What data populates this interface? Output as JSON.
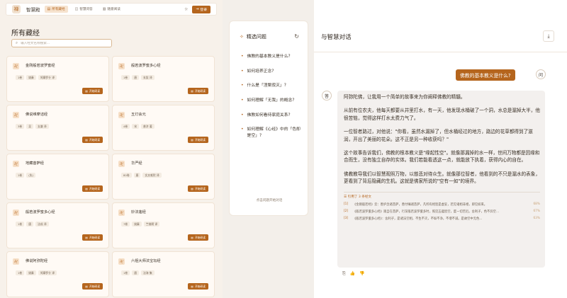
{
  "nav": {
    "brand_icon": "禅",
    "brand_name": "智慧殿",
    "tabs": [
      {
        "label": "所有藏经",
        "icon": "book-icon",
        "glyph": "▤",
        "active": true
      },
      {
        "label": "智慧问答",
        "icon": "chat-icon",
        "glyph": "◫",
        "active": false
      },
      {
        "label": "随意阅读",
        "icon": "read-icon",
        "glyph": "▥",
        "active": false
      }
    ],
    "theme_icon": "☼",
    "login_label": "登录",
    "login_icon": "⇥"
  },
  "library": {
    "title": "所有藏经",
    "search_placeholder": "输入经文名称搜索...",
    "start_label": "开始研读",
    "cards": [
      {
        "icon": "卍",
        "name": "金刚般若波罗蜜经",
        "tags": [
          "1卷",
          "姚秦",
          "鸠摩罗什 译"
        ]
      },
      {
        "icon": "卍",
        "name": "般若波罗蜜多心经",
        "tags": [
          "1卷",
          "唐",
          "玄奘 译"
        ]
      },
      {
        "icon": "卍",
        "name": "佛说维摩诘经",
        "tags": [
          "3卷",
          "吴",
          "支谦 译"
        ]
      },
      {
        "icon": "卍",
        "name": "五灯会元",
        "tags": [
          "4卷",
          "宋",
          "普济 著"
        ]
      },
      {
        "icon": "卍",
        "name": "地藏菩萨经",
        "tags": [
          "1卷",
          "(失)"
        ]
      },
      {
        "icon": "卍",
        "name": "华严经",
        "tags": [
          "80卷",
          "唐",
          "实叉难陀 译"
        ]
      },
      {
        "icon": "卍",
        "name": "般若波罗蜜多心经",
        "tags": [
          "1卷",
          "唐",
          "法成 译"
        ]
      },
      {
        "icon": "卍",
        "name": "妙法莲经",
        "tags": [
          "7卷",
          "姚秦",
          "竺佛朔 译"
        ]
      },
      {
        "icon": "卍",
        "name": "佛说阿弥陀经",
        "tags": [
          "1卷",
          "姚秦",
          "鸠摩罗什 译"
        ]
      },
      {
        "icon": "卍",
        "name": "六祖大师法宝坛经",
        "tags": [
          "1卷",
          "唐",
          "法海 集"
        ]
      }
    ]
  },
  "questions": {
    "title": "精选问题",
    "title_icon": "✧",
    "refresh_icon": "↻",
    "items": [
      "佛教的基本教义是什么?",
      "如何培养正念?",
      "什么是「涅槃寂灭」?",
      "如何理解「无我」的概念?",
      "佛教如何看待家庭关系?",
      "如何理解《心经》中的「色即是空」?"
    ],
    "footer": "点击问题开始对话"
  },
  "chat": {
    "title": "与智慧对话",
    "download_icon": "⤓",
    "user_avatar": "问",
    "assistant_avatar": "答",
    "user_message": "佛教的基本教义是什么?",
    "answer": [
      "阿弥陀佛，让我用一个简单的故事来为你阐释佛教的精髓。",
      "从前有位农夫，他每天都要从井里打水，有一天，他发现水桶破了一个洞，水总是漏掉大半，他很苦恼，觉得这样打水太费力气了。",
      "一位智者路过，对他说：\"你看，虽然水漏掉了，但水桶经过的地方，路边的花草都得到了滋润，开出了美丽的花朵。这不正是另一种收获吗？\"",
      "这个故事告诉我们，佛教的根本教义是\"缘起性空\"。就像那漏掉的水一样，世间万物都是因缘和合而生，没有独立自存的实体。我们若能看透这一点，就能放下执着，获得内心的自在。",
      "佛教教导我们以智慧观照万物，以慈悲对待众生。就像那位智者，他看到的不只是漏水的表象，更看到了背后隐藏的生机。这就是佛家所说的\"空有一如\"的境界。"
    ],
    "refs_title": "引用了 3 条经文",
    "refs_icon": "☰",
    "refs": [
      {
        "idx": "[1]",
        "text": "《金刚般若经》云：善护念诸菩萨，善付嘱诸菩萨，凡所有相皆是虚妄，若见诸相非相，即见如来。",
        "pct": "68%"
      },
      {
        "idx": "[2]",
        "text": "《般若波罗蜜多心经》观自在菩萨，行深般若波罗蜜多时，照见五蕴皆空，度一切苦厄。舍利子，色不异空...",
        "pct": "67%"
      },
      {
        "idx": "[3]",
        "text": "《般若波罗蜜多心经》：舍利子，是诸法空相，不生不灭，不垢不净，不增不减。是故空中无色...",
        "pct": "63%"
      }
    ],
    "actions": [
      {
        "icon": "copy-icon",
        "glyph": "⎘"
      },
      {
        "icon": "thumbs-up-icon",
        "glyph": "👍"
      },
      {
        "icon": "thumbs-down-icon",
        "glyph": "👎"
      }
    ]
  }
}
